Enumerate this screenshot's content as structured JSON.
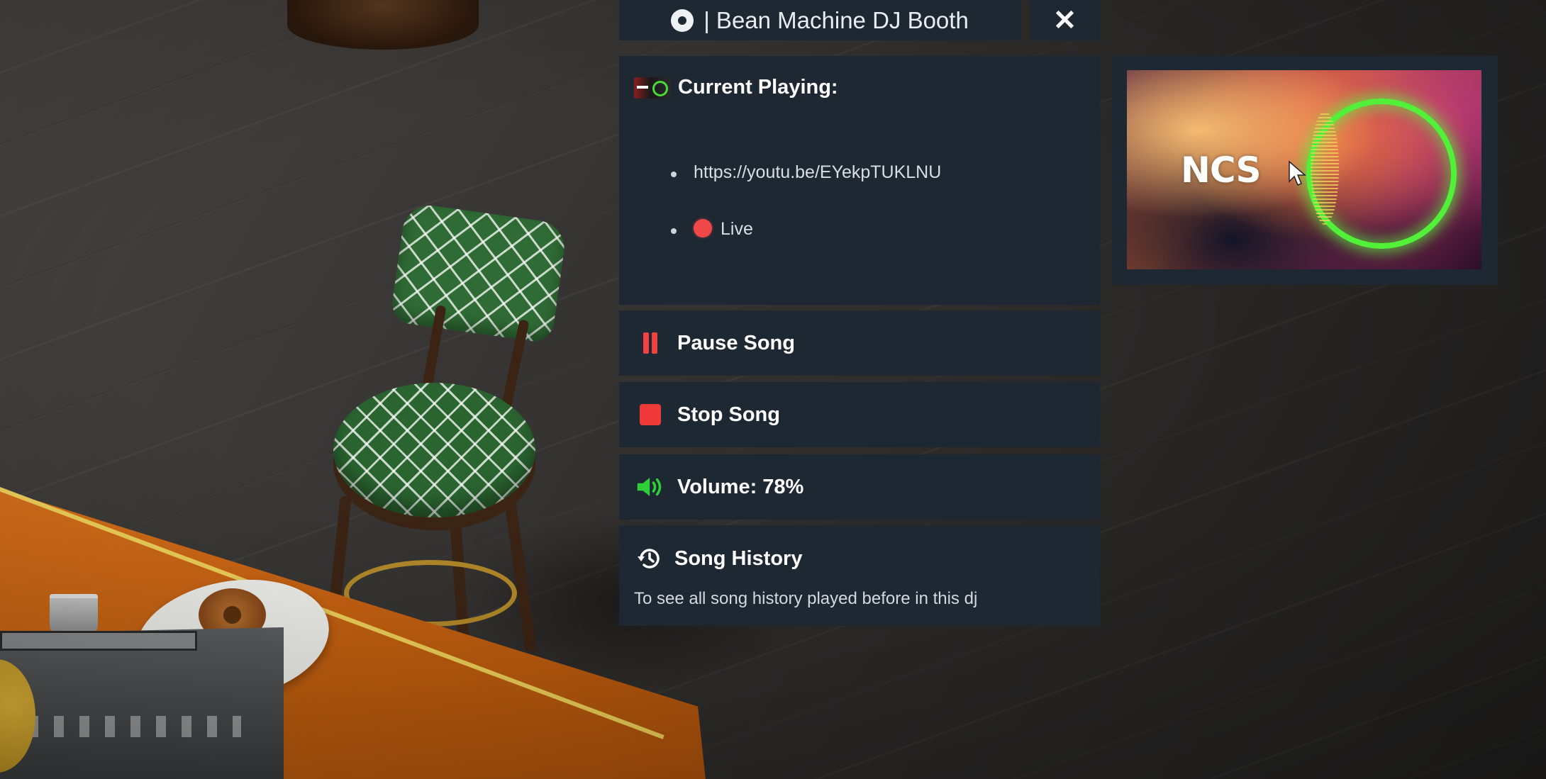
{
  "window": {
    "title": "| Bean Machine DJ Booth",
    "close_symbol": "✕"
  },
  "current": {
    "heading": "Current Playing:",
    "url": "https://youtu.be/EYekpTUKLNU",
    "status": "Live"
  },
  "controls": {
    "pause_label": "Pause Song",
    "stop_label": "Stop Song",
    "volume_label": "Volume: 78%",
    "volume_percent": 78
  },
  "history": {
    "title": "Song History",
    "description": "To see all song history played before in this dj"
  },
  "video": {
    "logo_text": "NCS"
  },
  "colors": {
    "panel_bg": "#1d2833",
    "pause_red": "#f24141",
    "stop_red": "#f03a3a",
    "live_red": "#f04848",
    "volume_green": "#2fcf3a",
    "ncs_green": "#53f03a"
  },
  "icons": {
    "title": "disc-icon",
    "close": "close-icon",
    "current": "now-playing-icon",
    "live": "live-dot-icon",
    "pause": "pause-icon",
    "stop": "stop-icon",
    "volume": "volume-icon",
    "history": "history-icon"
  }
}
